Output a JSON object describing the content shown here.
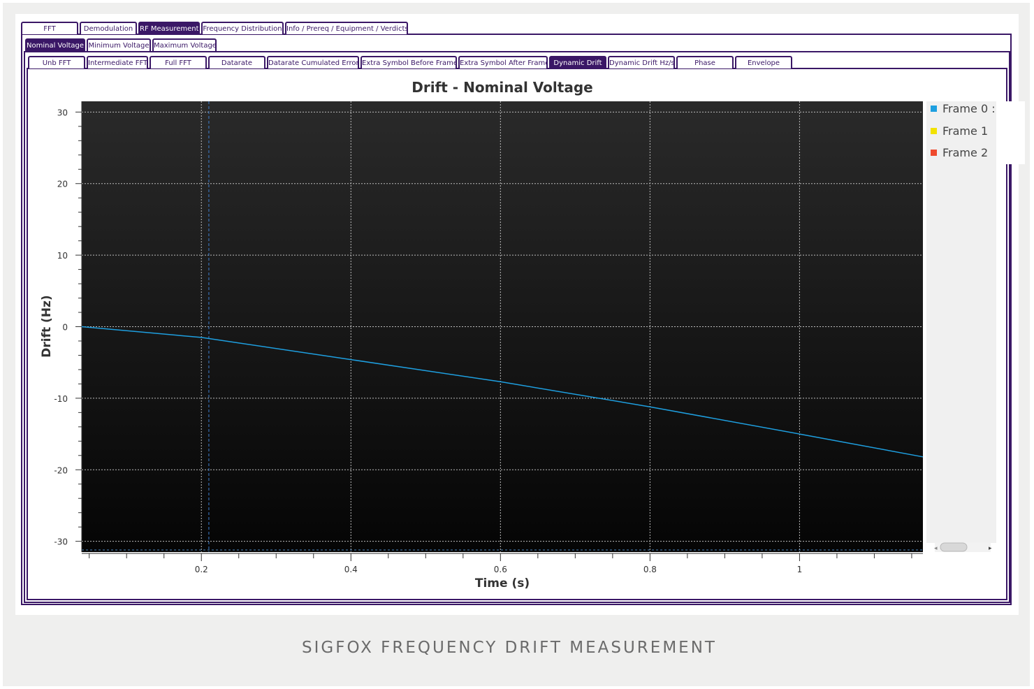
{
  "tabs_level1": [
    {
      "label": "FFT",
      "active": false
    },
    {
      "label": "Demodulation",
      "active": false
    },
    {
      "label": "RF Measurement",
      "active": true
    },
    {
      "label": "Frequency Distribution",
      "active": false
    },
    {
      "label": "Info / Prereq / Equipment / Verdicts",
      "active": false
    }
  ],
  "tabs_level2": [
    {
      "label": "Nominal Voltage",
      "active": true
    },
    {
      "label": "Minimum Voltage",
      "active": false
    },
    {
      "label": "Maximum Voltage",
      "active": false
    }
  ],
  "tabs_level3": [
    {
      "label": "Unb FFT",
      "active": false
    },
    {
      "label": "Intermediate FFT",
      "active": false
    },
    {
      "label": "Full FFT",
      "active": false
    },
    {
      "label": "Datarate",
      "active": false
    },
    {
      "label": "Datarate Cumulated Error",
      "active": false
    },
    {
      "label": "Extra Symbol Before Frame",
      "active": false
    },
    {
      "label": "Extra Symbol After Frame",
      "active": false
    },
    {
      "label": "Dynamic Drift",
      "active": true
    },
    {
      "label": "Dynamic Drift Hz/s",
      "active": false
    },
    {
      "label": "Phase",
      "active": false
    },
    {
      "label": "Envelope",
      "active": false
    }
  ],
  "caption": "SIGFOX FREQUENCY DRIFT MEASUREMENT",
  "colors": {
    "accent": "#3a1766",
    "series1": "#1e9fe0",
    "series2": "#f2e200",
    "series3": "#ef4a2e"
  },
  "chart_data": {
    "type": "line",
    "title": "Drift - Nominal Voltage",
    "xlabel": "Time (s)",
    "ylabel": "Drift (Hz)",
    "xlim": [
      0.04,
      1.165
    ],
    "ylim": [
      -31.5,
      31.5
    ],
    "xticks": [
      0.2,
      0.4,
      0.6,
      0.8,
      1
    ],
    "xtick_labels": [
      "0.2",
      "0.4",
      "0.6",
      "0.8",
      "1"
    ],
    "yticks": [
      30,
      20,
      10,
      0,
      -10,
      -20,
      -30
    ],
    "ytick_labels": [
      "30",
      "20",
      "10",
      "0",
      "-10",
      "-20",
      "-30"
    ],
    "grid": true,
    "legend_position": "right",
    "cursor_x": 0.21,
    "series": [
      {
        "name": "Frame 0 : ",
        "x": [
          0.04,
          0.2,
          0.4,
          0.6,
          0.8,
          1.0,
          1.165
        ],
        "y": [
          0,
          -1.5,
          -4.6,
          -7.7,
          -11.2,
          -15.0,
          -18.2
        ]
      },
      {
        "name": "Frame 1",
        "x": [],
        "y": []
      },
      {
        "name": "Frame 2",
        "x": [],
        "y": []
      }
    ]
  }
}
